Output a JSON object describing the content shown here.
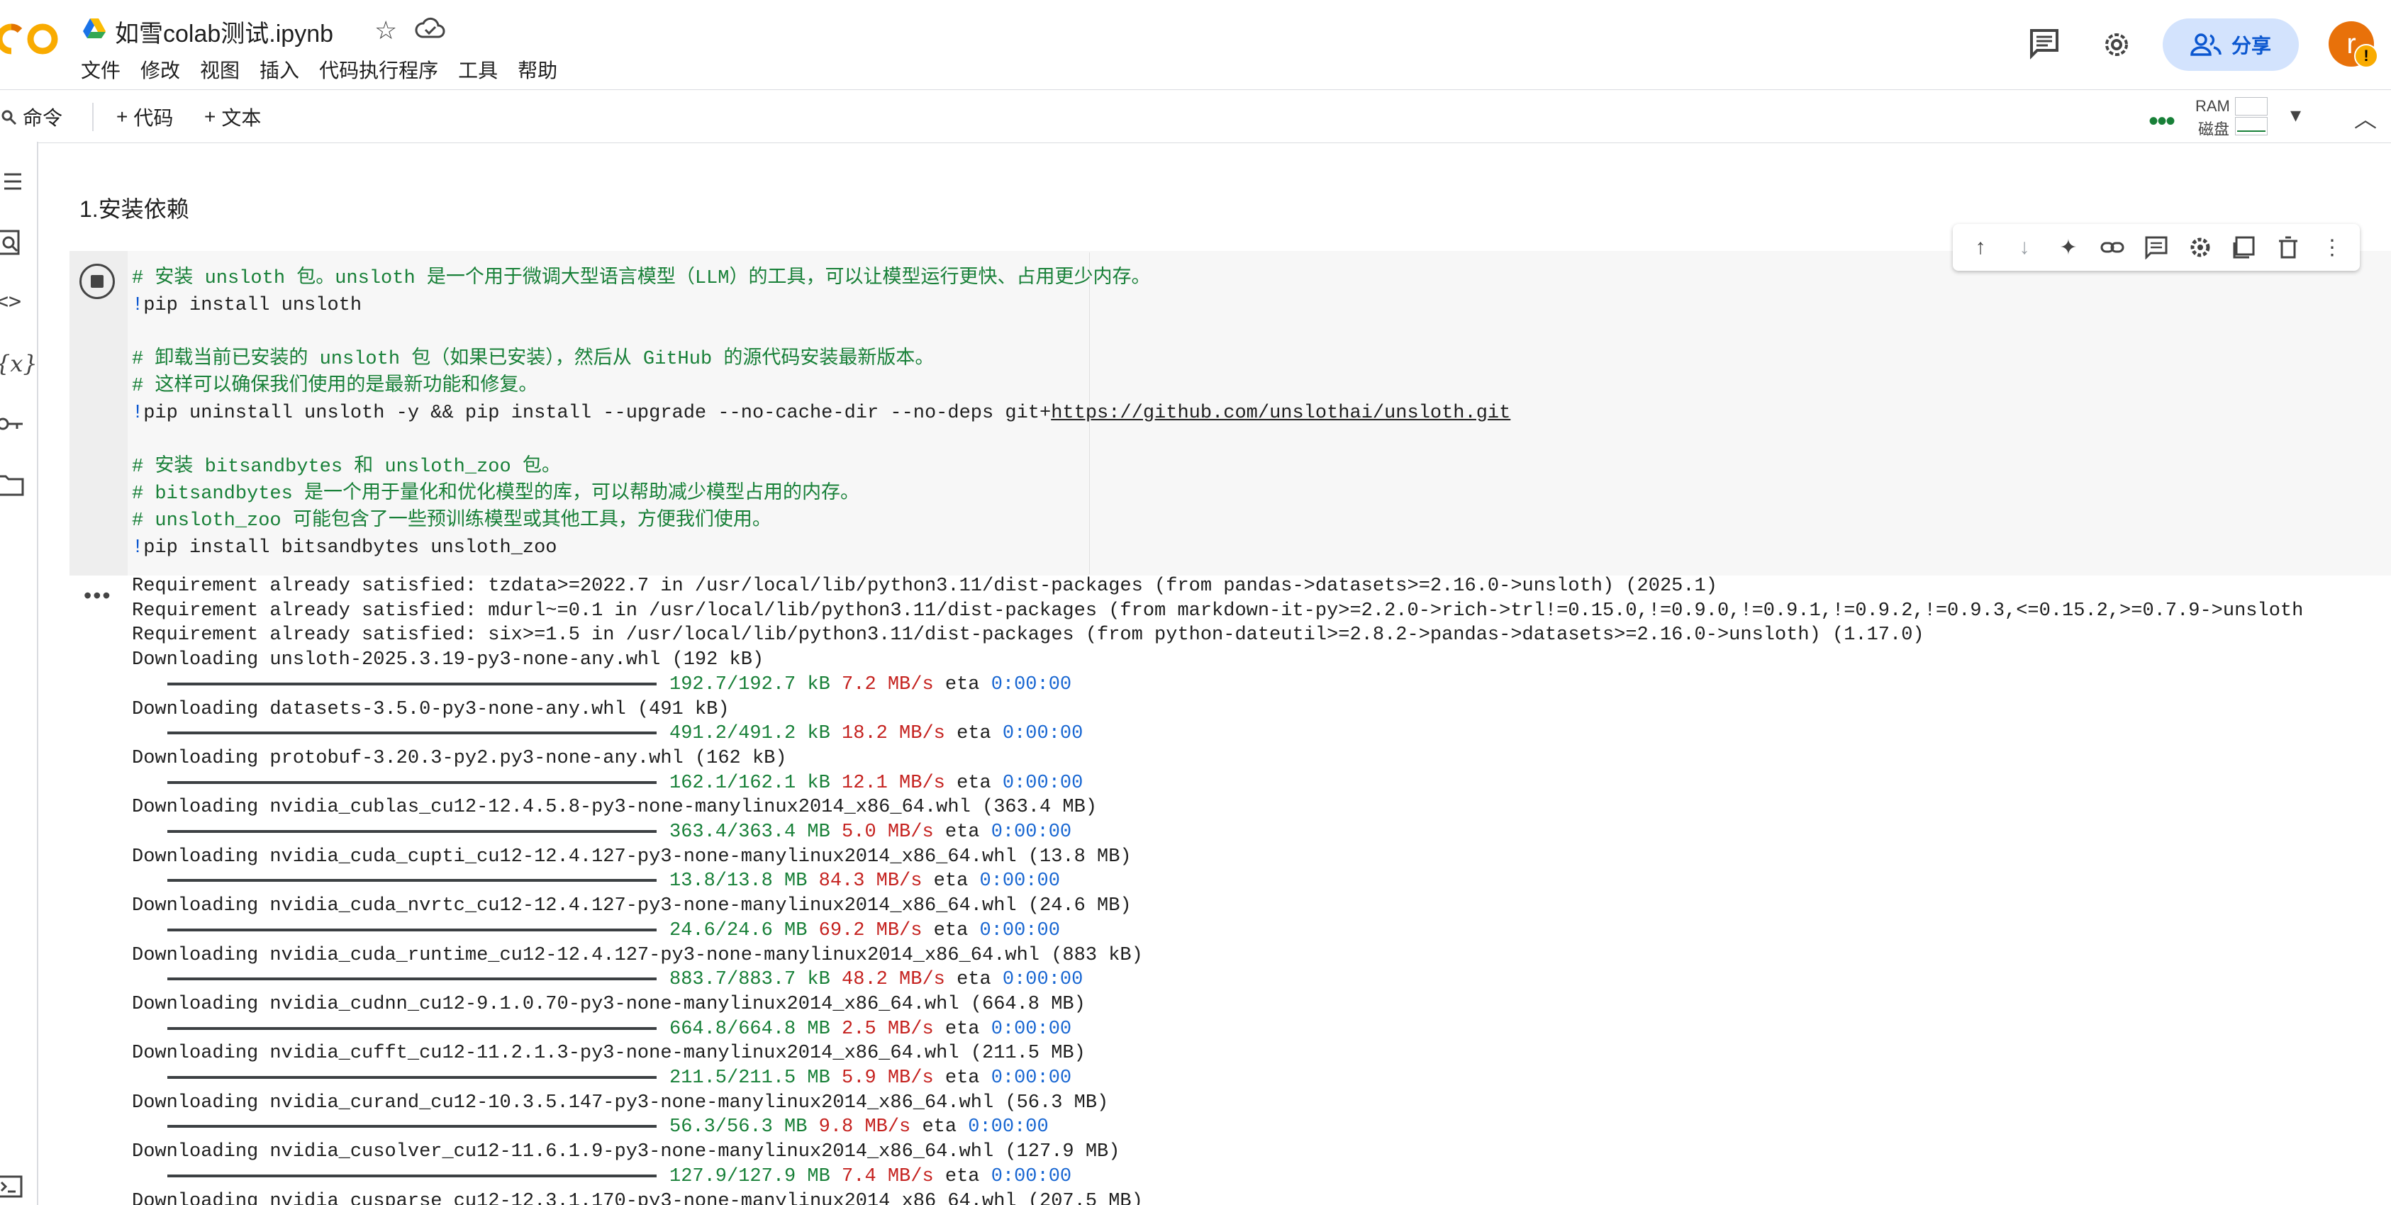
{
  "header": {
    "doc_title": "如雪colab测试.ipynb",
    "menu": [
      "文件",
      "修改",
      "视图",
      "插入",
      "代码执行程序",
      "工具",
      "帮助"
    ],
    "share_label": "分享",
    "avatar_initial": "r",
    "avatar_badge": "!"
  },
  "toolbar": {
    "command_label": "命令",
    "add_code_label": "代码",
    "add_text_label": "文本",
    "ram_label": "RAM",
    "disk_label": "磁盘"
  },
  "notebook": {
    "section_heading": "1.安装依赖",
    "code_lines": [
      {
        "type": "cmt",
        "text": "# 安装 unsloth 包。unsloth 是一个用于微调大型语言模型（LLM）的工具，可以让模型运行更快、占用更少内存。"
      },
      {
        "type": "cmd",
        "bang": "!",
        "text": "pip install unsloth"
      },
      {
        "type": "blank",
        "text": ""
      },
      {
        "type": "cmt",
        "text": "# 卸载当前已安装的 unsloth 包（如果已安装），然后从 GitHub 的源代码安装最新版本。"
      },
      {
        "type": "cmt",
        "text": "# 这样可以确保我们使用的是最新功能和修复。"
      },
      {
        "type": "cmd",
        "bang": "!",
        "text": "pip uninstall unsloth -y && pip install --upgrade --no-cache-dir --no-deps git+",
        "link": "https://github.com/unslothai/unsloth.git"
      },
      {
        "type": "blank",
        "text": ""
      },
      {
        "type": "cmt",
        "text": "# 安装 bitsandbytes 和 unsloth_zoo 包。"
      },
      {
        "type": "cmt",
        "text": "# bitsandbytes 是一个用于量化和优化模型的库，可以帮助减少模型占用的内存。"
      },
      {
        "type": "cmt",
        "text": "# unsloth_zoo 可能包含了一些预训练模型或其他工具，方便我们使用。"
      },
      {
        "type": "cmd",
        "bang": "!",
        "text": "pip install bitsandbytes unsloth_zoo"
      }
    ],
    "output_lines": [
      {
        "type": "text",
        "text": "Requirement already satisfied: tzdata>=2022.7 in /usr/local/lib/python3.11/dist-packages (from pandas->datasets>=2.16.0->unsloth) (2025.1)"
      },
      {
        "type": "text",
        "text": "Requirement already satisfied: mdurl~=0.1 in /usr/local/lib/python3.11/dist-packages (from markdown-it-py>=2.2.0->rich->trl!=0.15.0,!=0.9.0,!=0.9.1,!=0.9.2,!=0.9.3,<=0.15.2,>=0.7.9->unsloth"
      },
      {
        "type": "text",
        "text": "Requirement already satisfied: six>=1.5 in /usr/local/lib/python3.11/dist-packages (from python-dateutil>=2.8.2->pandas->datasets>=2.16.0->unsloth) (1.17.0)"
      },
      {
        "type": "text",
        "text": "Downloading unsloth-2025.3.19-py3-none-any.whl (192 kB)"
      },
      {
        "type": "bar",
        "progress": "192.7/192.7 kB",
        "rate": "7.2 MB/s",
        "eta": "eta",
        "eta_value": "0:00:00"
      },
      {
        "type": "text",
        "text": "Downloading datasets-3.5.0-py3-none-any.whl (491 kB)"
      },
      {
        "type": "bar",
        "progress": "491.2/491.2 kB",
        "rate": "18.2 MB/s",
        "eta": "eta",
        "eta_value": "0:00:00"
      },
      {
        "type": "text",
        "text": "Downloading protobuf-3.20.3-py2.py3-none-any.whl (162 kB)"
      },
      {
        "type": "bar",
        "progress": "162.1/162.1 kB",
        "rate": "12.1 MB/s",
        "eta": "eta",
        "eta_value": "0:00:00"
      },
      {
        "type": "text",
        "text": "Downloading nvidia_cublas_cu12-12.4.5.8-py3-none-manylinux2014_x86_64.whl (363.4 MB)"
      },
      {
        "type": "bar",
        "progress": "363.4/363.4 MB",
        "rate": "5.0 MB/s",
        "eta": "eta",
        "eta_value": "0:00:00"
      },
      {
        "type": "text",
        "text": "Downloading nvidia_cuda_cupti_cu12-12.4.127-py3-none-manylinux2014_x86_64.whl (13.8 MB)"
      },
      {
        "type": "bar",
        "progress": "13.8/13.8 MB",
        "rate": "84.3 MB/s",
        "eta": "eta",
        "eta_value": "0:00:00"
      },
      {
        "type": "text",
        "text": "Downloading nvidia_cuda_nvrtc_cu12-12.4.127-py3-none-manylinux2014_x86_64.whl (24.6 MB)"
      },
      {
        "type": "bar",
        "progress": "24.6/24.6 MB",
        "rate": "69.2 MB/s",
        "eta": "eta",
        "eta_value": "0:00:00"
      },
      {
        "type": "text",
        "text": "Downloading nvidia_cuda_runtime_cu12-12.4.127-py3-none-manylinux2014_x86_64.whl (883 kB)"
      },
      {
        "type": "bar",
        "progress": "883.7/883.7 kB",
        "rate": "48.2 MB/s",
        "eta": "eta",
        "eta_value": "0:00:00"
      },
      {
        "type": "text",
        "text": "Downloading nvidia_cudnn_cu12-9.1.0.70-py3-none-manylinux2014_x86_64.whl (664.8 MB)"
      },
      {
        "type": "bar",
        "progress": "664.8/664.8 MB",
        "rate": "2.5 MB/s",
        "eta": "eta",
        "eta_value": "0:00:00"
      },
      {
        "type": "text",
        "text": "Downloading nvidia_cufft_cu12-11.2.1.3-py3-none-manylinux2014_x86_64.whl (211.5 MB)"
      },
      {
        "type": "bar",
        "progress": "211.5/211.5 MB",
        "rate": "5.9 MB/s",
        "eta": "eta",
        "eta_value": "0:00:00"
      },
      {
        "type": "text",
        "text": "Downloading nvidia_curand_cu12-10.3.5.147-py3-none-manylinux2014_x86_64.whl (56.3 MB)"
      },
      {
        "type": "bar",
        "progress": "56.3/56.3 MB",
        "rate": "9.8 MB/s",
        "eta": "eta",
        "eta_value": "0:00:00"
      },
      {
        "type": "text",
        "text": "Downloading nvidia_cusolver_cu12-11.6.1.9-py3-none-manylinux2014_x86_64.whl (127.9 MB)"
      },
      {
        "type": "bar",
        "progress": "127.9/127.9 MB",
        "rate": "7.4 MB/s",
        "eta": "eta",
        "eta_value": "0:00:00"
      },
      {
        "type": "text",
        "text": "Downloading nvidia_cusparse_cu12-12.3.1.170-py3-none-manylinux2014_x86_64.whl (207.5 MB)"
      }
    ]
  },
  "icons": {
    "drive": "drive-icon",
    "star": "star-icon",
    "cloud": "cloud-icon",
    "comment": "comment-icon",
    "settings": "gear-icon",
    "share": "people-icon",
    "search": "search-icon"
  },
  "colors": {
    "accent": "#0b57d0",
    "share_bg": "#d3e3fd",
    "comment_green": "#188038",
    "rate_red": "#c5221f",
    "eta_blue": "#1967d2",
    "avatar": "#e8710a"
  }
}
